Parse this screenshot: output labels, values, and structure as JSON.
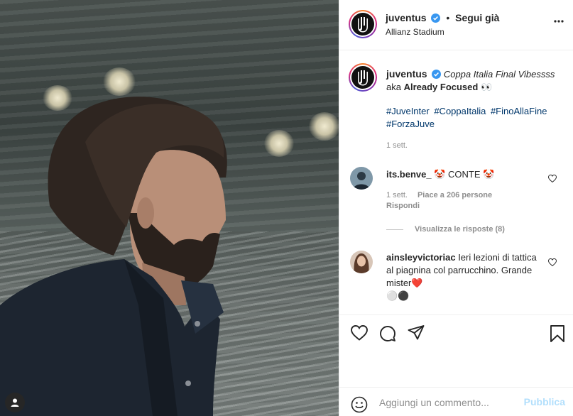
{
  "post": {
    "username": "juventus",
    "follow_status": "Segui già",
    "separator": "•",
    "location": "Allianz Stadium"
  },
  "caption": {
    "username": "juventus",
    "title": "Coppa Italia Final Vibessss",
    "line2_prefix": "aka ",
    "line2_bold": "Already Focused",
    "emoji": "👀",
    "hashtags": [
      "#JuveInter",
      "#CoppaItalia",
      "#FinoAllaFine",
      "#ForzaJuve"
    ],
    "time": "1 sett."
  },
  "comments": [
    {
      "username": "its.benve_",
      "text": "🤡 CONTE 🤡",
      "time": "1 sett.",
      "likes": "Piace a 206 persone",
      "reply": "Rispondi",
      "view_replies": "Visualizza le risposte (8)"
    },
    {
      "username": "ainsleyvictoriac",
      "text": "Ieri lezioni di tattica al piagnina col parrucchino. Grande mister❤️",
      "emoji": "⚪⚫"
    }
  ],
  "add_comment": {
    "placeholder": "Aggiungi un commento...",
    "publish": "Pubblica"
  },
  "colors": {
    "verified": "#3897f0",
    "link": "#00376b",
    "publish_disabled": "#b2dffc"
  }
}
